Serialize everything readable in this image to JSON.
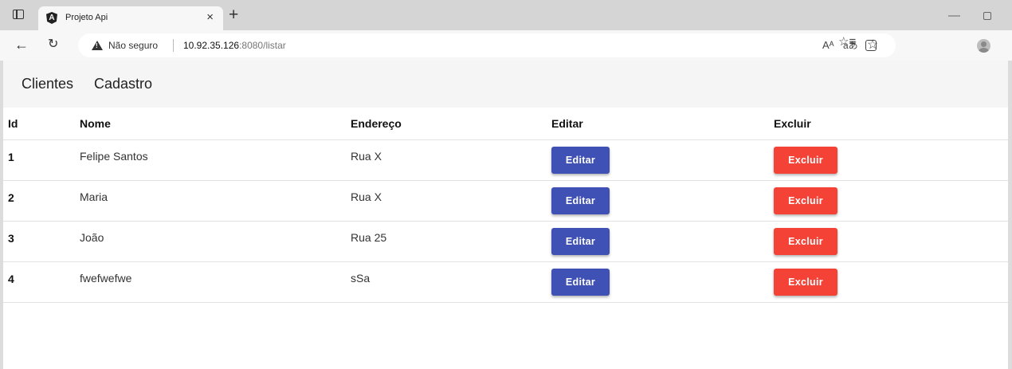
{
  "browser": {
    "tab_title": "Projeto Api",
    "tab_close": "×",
    "new_tab": "+",
    "security_label": "Não seguro",
    "url_host": "10.92.35.126",
    "url_rest": ":8080/listar",
    "read_aloud": "Aᴬ",
    "translate": "aあ",
    "favorites": "☆≡"
  },
  "nav": {
    "clientes": "Clientes",
    "cadastro": "Cadastro"
  },
  "table": {
    "headers": {
      "id": "Id",
      "nome": "Nome",
      "endereco": "Endereço",
      "editar": "Editar",
      "excluir": "Excluir"
    },
    "rows": [
      {
        "id": "1",
        "nome": "Felipe Santos",
        "endereco": "Rua X",
        "edit_label": "Editar",
        "delete_label": "Excluir"
      },
      {
        "id": "2",
        "nome": "Maria",
        "endereco": "Rua X",
        "edit_label": "Editar",
        "delete_label": "Excluir"
      },
      {
        "id": "3",
        "nome": "João",
        "endereco": "Rua 25",
        "edit_label": "Editar",
        "delete_label": "Excluir"
      },
      {
        "id": "4",
        "nome": "fwefwefwe",
        "endereco": "sSa",
        "edit_label": "Editar",
        "delete_label": "Excluir"
      }
    ]
  },
  "colors": {
    "edit_button": "#3f51b5",
    "delete_button": "#f44336"
  }
}
